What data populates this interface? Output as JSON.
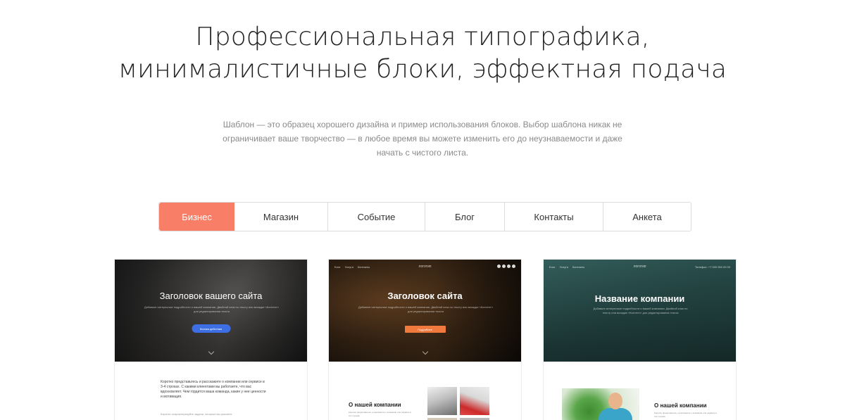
{
  "hero": {
    "title_line1": "Профессиональная типографика,",
    "title_line2": "минималистичные блоки, эффектная подача",
    "desc_line1": "Шаблон — это образец хорошего дизайна и пример использования блоков. Выбор шаблона никак не",
    "desc_line2": "ограничивает ваше творчество — в любое время вы можете изменить его до неузнаваемости и даже",
    "desc_line3": "начать с чистого листа."
  },
  "tabs": [
    {
      "label": "Бизнес",
      "active": true
    },
    {
      "label": "Магазин",
      "active": false
    },
    {
      "label": "Событие",
      "active": false
    },
    {
      "label": "Блог",
      "active": false
    },
    {
      "label": "Контакты",
      "active": false
    },
    {
      "label": "Анкета",
      "active": false
    }
  ],
  "cards": [
    {
      "title": "Заголовок вашего сайта",
      "subtitle": "Добавьте интересные подробности о вашей компании. Двойной клик по тексту или вкладке «Контент» для редактирования текста",
      "button": "Кнопка действия",
      "body_text": "Коротко представьтесь и расскажите о компании или сервисе в 3-4 строках. С какими клиентами вы работаете, что вас вдохновляет. Чем гордится ваша команда, какие у нее ценности и мотивация.",
      "body_note": "Коротко охарактеризуйте задачи, которые вы решаете"
    },
    {
      "nav": [
        "Блог",
        "Услуги",
        "Контакты"
      ],
      "logo": "логотип",
      "title": "Заголовок сайта",
      "subtitle": "Добавьте интересные подробности о вашей компании. Двойной клик по тексту или вкладке «Контент» для редактирования текста",
      "button": "Подробнее",
      "about": "О нашей компании",
      "about_text": "Коротко представьтесь и расскажите о компании или сервисе в 3-4 строках"
    },
    {
      "nav": [
        "Блог",
        "Услуги",
        "Контакты"
      ],
      "logo": "логотип",
      "phone": "Телефон: +7 000 000 00 00",
      "title": "Название компании",
      "subtitle": "Добавьте интересные подробности о вашей компании. Двойной клик по тексту или вкладке «Контент» для редактирования текста",
      "about": "О нашей компании",
      "about_text": "Коротко представьтесь и расскажите о компании или сервисе в 3-4 строках"
    }
  ],
  "colors": {
    "accent": "#f87e67",
    "card1_button": "#3d6ee3",
    "card2_button": "#f0793e"
  }
}
